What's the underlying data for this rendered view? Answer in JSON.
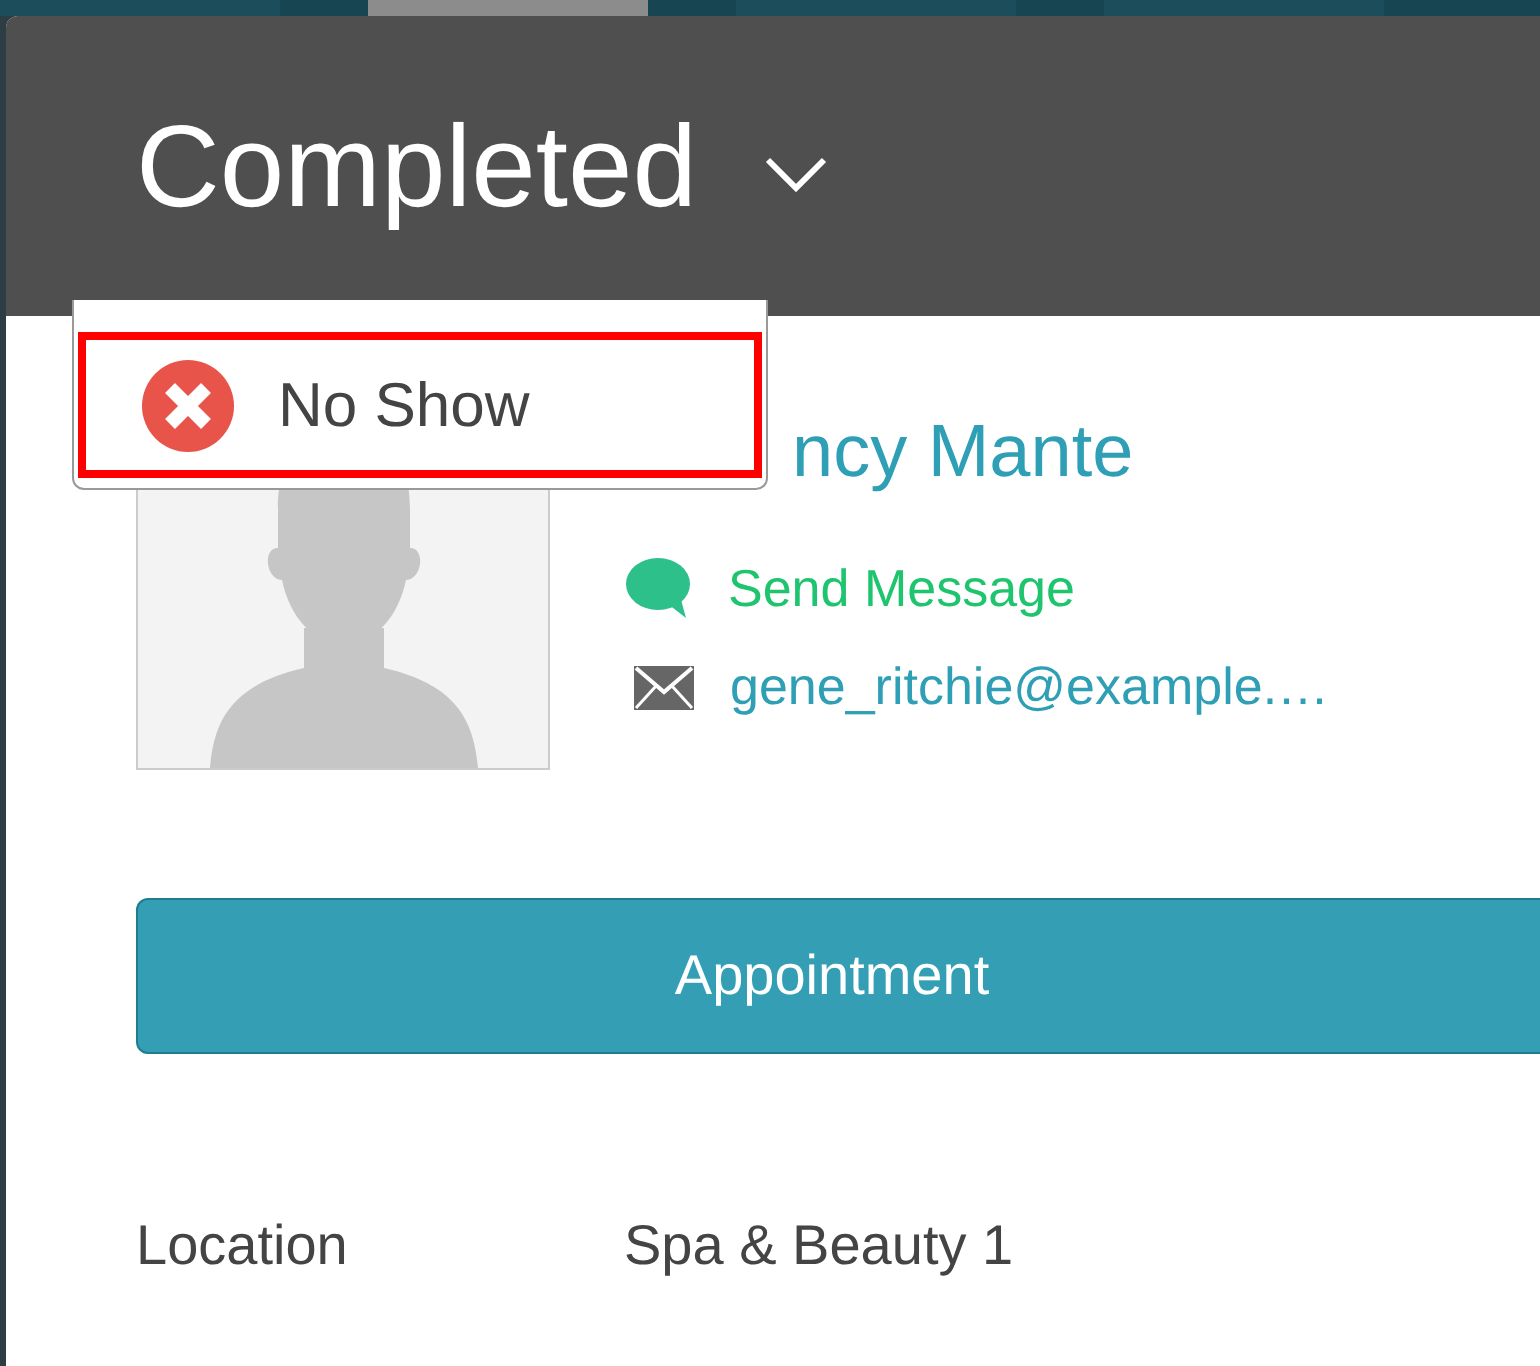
{
  "nav_tabs": [
    {
      "selected": false
    },
    {
      "selected": true
    },
    {
      "selected": false
    },
    {
      "selected": false
    }
  ],
  "dialog": {
    "status": "Completed",
    "status_menu": {
      "items": [
        {
          "label": "No Show",
          "highlighted": true
        }
      ]
    },
    "client": {
      "name": "ncy Mante",
      "send_message": "Send Message",
      "email": "gene_ritchie@example.…"
    },
    "appointment_button": "Appointment",
    "details": [
      {
        "label": "Location",
        "value": "Spa & Beauty 1"
      }
    ]
  }
}
